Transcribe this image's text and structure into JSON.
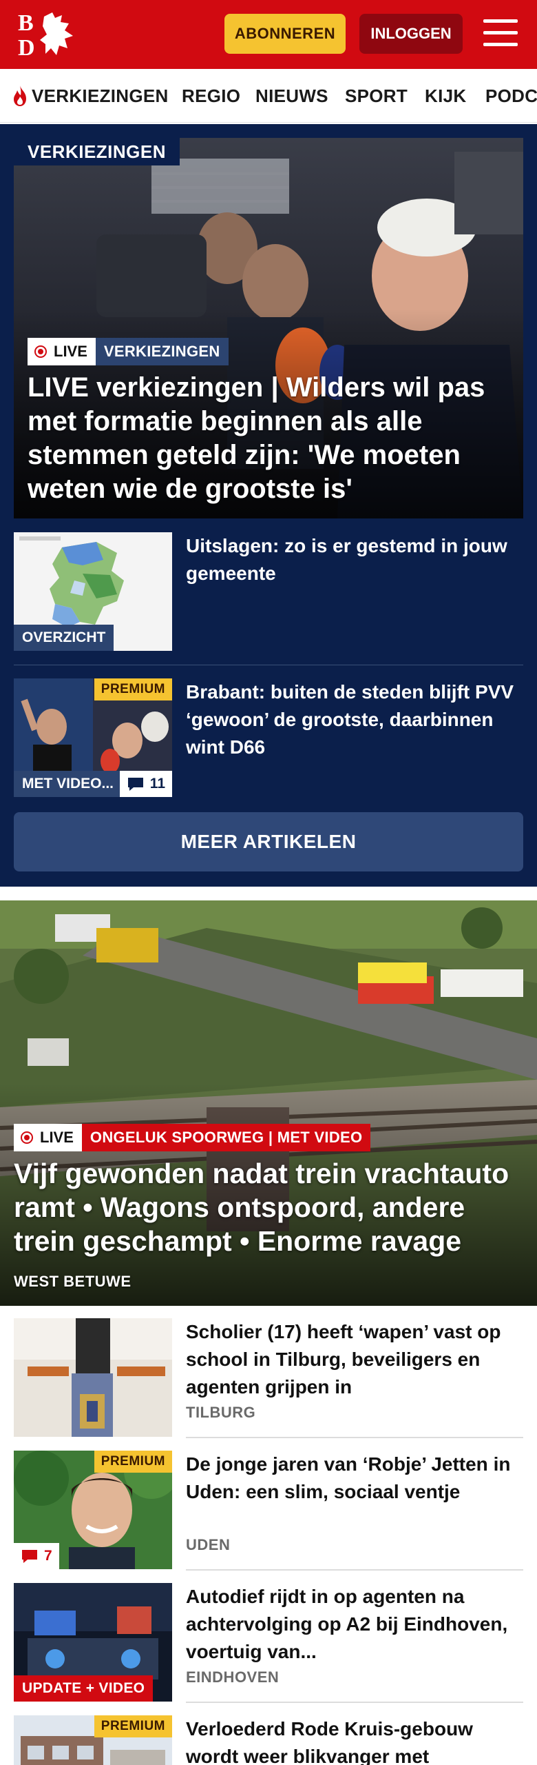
{
  "header": {
    "logo_text": "BD",
    "subscribe_label": "ABONNEREN",
    "login_label": "INLOGGEN"
  },
  "nav": {
    "items": [
      {
        "label": "VERKIEZINGEN",
        "icon": "flame-icon"
      },
      {
        "label": "REGIO"
      },
      {
        "label": "NIEUWS"
      },
      {
        "label": "SPORT"
      },
      {
        "label": "KIJK"
      },
      {
        "label": "PODCAST"
      }
    ]
  },
  "elections": {
    "section_label": "VERKIEZINGEN",
    "hero": {
      "live_label": "LIVE",
      "kicker": "VERKIEZINGEN",
      "title": "LIVE verkiezingen | Wilders wil pas met formatie beginnen als alle stemmen geteld zijn: 'We moeten weten wie de grootste is'"
    },
    "articles": [
      {
        "title": "Uitslagen: zo is er gestemd in jouw gemeente",
        "thumb_label": "OVERZICHT"
      },
      {
        "title": "Brabant: buiten de steden blijft PVV ‘gewoon’ de grootste, daarbinnen wint D66",
        "thumb_label": "MET VIDEO...",
        "premium_label": "PREMIUM",
        "comments": "11"
      }
    ],
    "more_label": "MEER ARTIKELEN"
  },
  "hero2": {
    "live_label": "LIVE",
    "kicker": "ONGELUK SPOORWEG | MET VIDEO",
    "title": "Vijf gewonden nadat trein vrachtauto ramt • Wagons ontspoord, andere trein geschampt • Enorme ravage",
    "location": "WEST BETUWE"
  },
  "list": [
    {
      "title": "Scholier (17) heeft ‘wapen’ vast op school in Tilburg, beveiligers en agenten grijpen in",
      "location": "TILBURG"
    },
    {
      "title": "De jonge jaren van ‘Robje’ Jetten in Uden: een slim, sociaal ventje",
      "location": "UDEN",
      "premium_label": "PREMIUM",
      "comments": "7"
    },
    {
      "title": "Autodief rijdt in op agenten na achtervolging op A2 bij Eindhoven, voertuig van...",
      "location": "EINDHOVEN",
      "thumb_label": "UPDATE + VIDEO"
    },
    {
      "title": "Verloederd Rode Kruis-gebouw wordt weer blikvanger met",
      "premium_label": "PREMIUM"
    }
  ],
  "colors": {
    "brand_red": "#d10a11",
    "navy": "#0b1f4b",
    "premium_yellow": "#f5c330"
  }
}
